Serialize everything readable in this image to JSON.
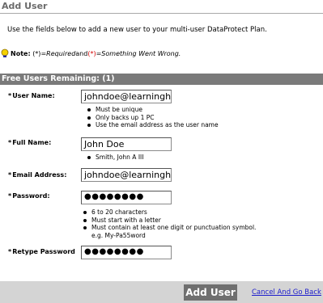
{
  "header": {
    "title": "Add User"
  },
  "intro": "Use the fields below to add a new user to your multi-user DataProtect Plan.",
  "note": {
    "label": "Note:",
    "req_mark": "(*)",
    "eq1": " = ",
    "required_text": "Required",
    "and_text": " and ",
    "err_mark": "(*)",
    "eq2": " = ",
    "error_text": "Something Went Wrong."
  },
  "section": {
    "label": "Free Users Remaining: (1)"
  },
  "fields": {
    "user_name": {
      "star": "*",
      "label": "User Name:",
      "value": "johndoe@learninghostin",
      "hints": [
        "Must be unique",
        "Only backs up 1 PC",
        "Use the email address as the user name"
      ]
    },
    "full_name": {
      "star": "*",
      "label": "Full Name:",
      "value": "John Doe",
      "hints": [
        "Smith, John A III"
      ]
    },
    "email": {
      "star": "*",
      "label": "Email Address:",
      "value": "johndoe@learninghostin"
    },
    "password": {
      "star": "*",
      "label": "Password:",
      "value": "●●●●●●●●",
      "hints": [
        "6 to 20 characters",
        "Must start with a letter",
        "Must contain at least one digit or punctuation symbol."
      ],
      "example": "e.g. My-Pa55word"
    },
    "retype": {
      "star": "*",
      "label": "Retype Password",
      "value": "●●●●●●●●"
    }
  },
  "footer": {
    "add_button": "Add User",
    "cancel_link": "Cancel And Go Back"
  },
  "colors": {
    "section_bar": "#7a7a7a",
    "footer_bar": "#d4d4d4",
    "error_mark": "#d40000",
    "link": "#1a1acc"
  },
  "icons": {
    "note": "lightbulb-note-icon"
  }
}
